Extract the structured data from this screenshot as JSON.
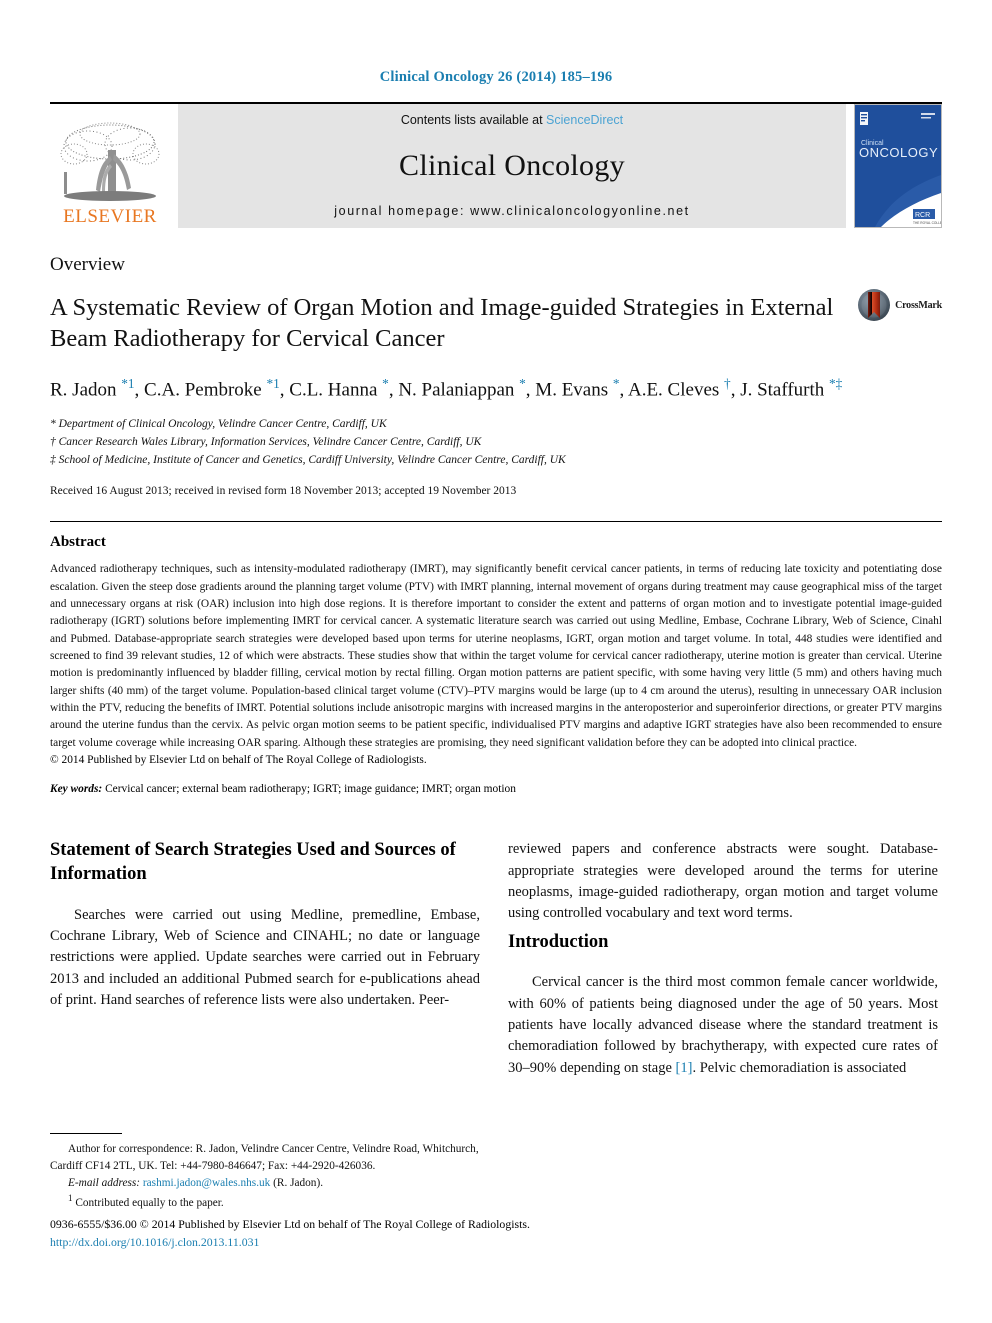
{
  "running_head": "Clinical Oncology 26 (2014) 185–196",
  "masthead": {
    "publisher_logo_label": "ELSEVIER",
    "contents_prefix": "Contents lists available at ",
    "contents_link": "ScienceDirect",
    "journal_name": "Clinical Oncology",
    "homepage_line": "journal homepage: www.clinicaloncologyonline.net",
    "cover_title_small": "Clinical",
    "cover_title_large": "ONCOLOGY"
  },
  "article": {
    "doctype": "Overview",
    "title": "A Systematic Review of Organ Motion and Image-guided Strategies in External Beam Radiotherapy for Cervical Cancer",
    "crossmark_label": "CrossMark",
    "authors_html": "R. Jadon <sup>*1</sup>, C.A. Pembroke <sup>*1</sup>, C.L. Hanna <sup>*</sup>, N. Palaniappan <sup>*</sup>, M. Evans <sup>*</sup>, A.E. Cleves <sup>†</sup>, J. Staffurth <sup>*‡</sup>",
    "affiliations": [
      "* Department of Clinical Oncology, Velindre Cancer Centre, Cardiff, UK",
      "† Cancer Research Wales Library, Information Services, Velindre Cancer Centre, Cardiff, UK",
      "‡ School of Medicine, Institute of Cancer and Genetics, Cardiff University, Velindre Cancer Centre, Cardiff, UK"
    ],
    "history": "Received 16 August 2013; received in revised form 18 November 2013; accepted 19 November 2013"
  },
  "abstract": {
    "heading": "Abstract",
    "body": "Advanced radiotherapy techniques, such as intensity-modulated radiotherapy (IMRT), may significantly benefit cervical cancer patients, in terms of reducing late toxicity and potentiating dose escalation. Given the steep dose gradients around the planning target volume (PTV) with IMRT planning, internal movement of organs during treatment may cause geographical miss of the target and unnecessary organs at risk (OAR) inclusion into high dose regions. It is therefore important to consider the extent and patterns of organ motion and to investigate potential image-guided radiotherapy (IGRT) solutions before implementing IMRT for cervical cancer. A systematic literature search was carried out using Medline, Embase, Cochrane Library, Web of Science, Cinahl and Pubmed. Database-appropriate search strategies were developed based upon terms for uterine neoplasms, IGRT, organ motion and target volume. In total, 448 studies were identified and screened to find 39 relevant studies, 12 of which were abstracts. These studies show that within the target volume for cervical cancer radiotherapy, uterine motion is greater than cervical. Uterine motion is predominantly influenced by bladder filling, cervical motion by rectal filling. Organ motion patterns are patient specific, with some having very little (5 mm) and others having much larger shifts (40 mm) of the target volume. Population-based clinical target volume (CTV)–PTV margins would be large (up to 4 cm around the uterus), resulting in unnecessary OAR inclusion within the PTV, reducing the benefits of IMRT. Potential solutions include anisotropic margins with increased margins in the anteroposterior and superoinferior directions, or greater PTV margins around the uterine fundus than the cervix. As pelvic organ motion seems to be patient specific, individualised PTV margins and adaptive IGRT strategies have also been recommended to ensure target volume coverage while increasing OAR sparing. Although these strategies are promising, they need significant validation before they can be adopted into clinical practice.",
    "copyright": "© 2014 Published by Elsevier Ltd on behalf of The Royal College of Radiologists.",
    "keywords_label": "Key words:",
    "keywords_value": " Cervical cancer; external beam radiotherapy; IGRT; image guidance; IMRT; organ motion"
  },
  "body": {
    "left_heading": "Statement of Search Strategies Used and Sources of Information",
    "left_paragraph": "Searches were carried out using Medline, premedline, Embase, Cochrane Library, Web of Science and CINAHL; no date or language restrictions were applied. Update searches were carried out in February 2013 and included an additional Pubmed search for e-publications ahead of print. Hand searches of reference lists were also undertaken. Peer-",
    "right_paragraph_continued": "reviewed papers and conference abstracts were sought. Database-appropriate strategies were developed around the terms for uterine neoplasms, image-guided radiotherapy, organ motion and target volume using controlled vocabulary and text word terms.",
    "right_heading": "Introduction",
    "right_paragraph_intro_a": "Cervical cancer is the third most common female cancer worldwide, with 60% of patients being diagnosed under the age of 50 years. Most patients have locally advanced disease where the standard treatment is chemoradiation followed by brachytherapy, with expected cure rates of 30–90% depending on stage ",
    "right_paragraph_ref": "[1]",
    "right_paragraph_intro_b": ". Pelvic chemoradiation is associated"
  },
  "footnotes": {
    "correspondence": "Author for correspondence: R. Jadon, Velindre Cancer Centre, Velindre Road, Whitchurch, Cardiff CF14 2TL, UK. Tel: +44-7980-846647; Fax: +44-2920-426036.",
    "email_label": "E-mail address:",
    "email_value": "rashmi.jadon@wales.nhs.uk",
    "email_suffix": " (R. Jadon).",
    "contributed_marker": "1",
    "contributed": "Contributed equally to the paper."
  },
  "imprint": {
    "line1": "0936-6555/$36.00 © 2014 Published by Elsevier Ltd on behalf of The Royal College of Radiologists.",
    "doi": "http://dx.doi.org/10.1016/j.clon.2013.11.031"
  },
  "colors": {
    "link_blue": "#1a7eb0",
    "sciencedirect_blue": "#4ba3d3",
    "elsevier_orange": "#E87722",
    "masthead_gray": "#e4e4e4",
    "cover_blue": "#1f4f9c",
    "crossmark_red": "#c1351d"
  }
}
